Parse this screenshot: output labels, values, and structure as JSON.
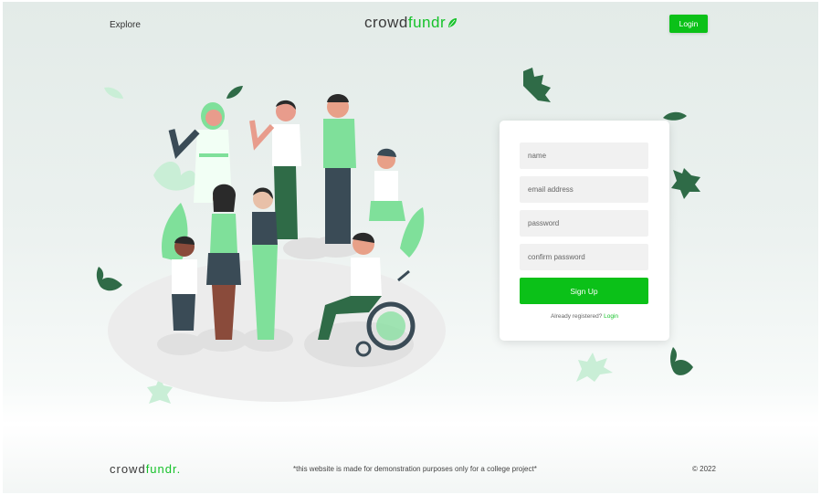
{
  "header": {
    "explore_label": "Explore",
    "logo_text_dark": "crowd",
    "logo_text_accent": "fundr",
    "login_label": "Login"
  },
  "form": {
    "name_placeholder": "name",
    "email_placeholder": "email address",
    "password_placeholder": "password",
    "confirm_password_placeholder": "confirm password",
    "signup_label": "Sign Up",
    "already_text": "Already registered?",
    "login_link": "Login"
  },
  "footer": {
    "logo_text_dark": "crowd",
    "logo_text_accent": "fundr.",
    "note": "*this website is made for demonstration purposes only for a college project*",
    "copyright": "© 2022"
  },
  "colors": {
    "accent": "#0bc118",
    "leaf_dark": "#2f6b47",
    "leaf_light": "#c9eed6"
  },
  "icons": {
    "logo_icon": "leaf-icon",
    "illustration": "diverse-people-group-illustration"
  }
}
